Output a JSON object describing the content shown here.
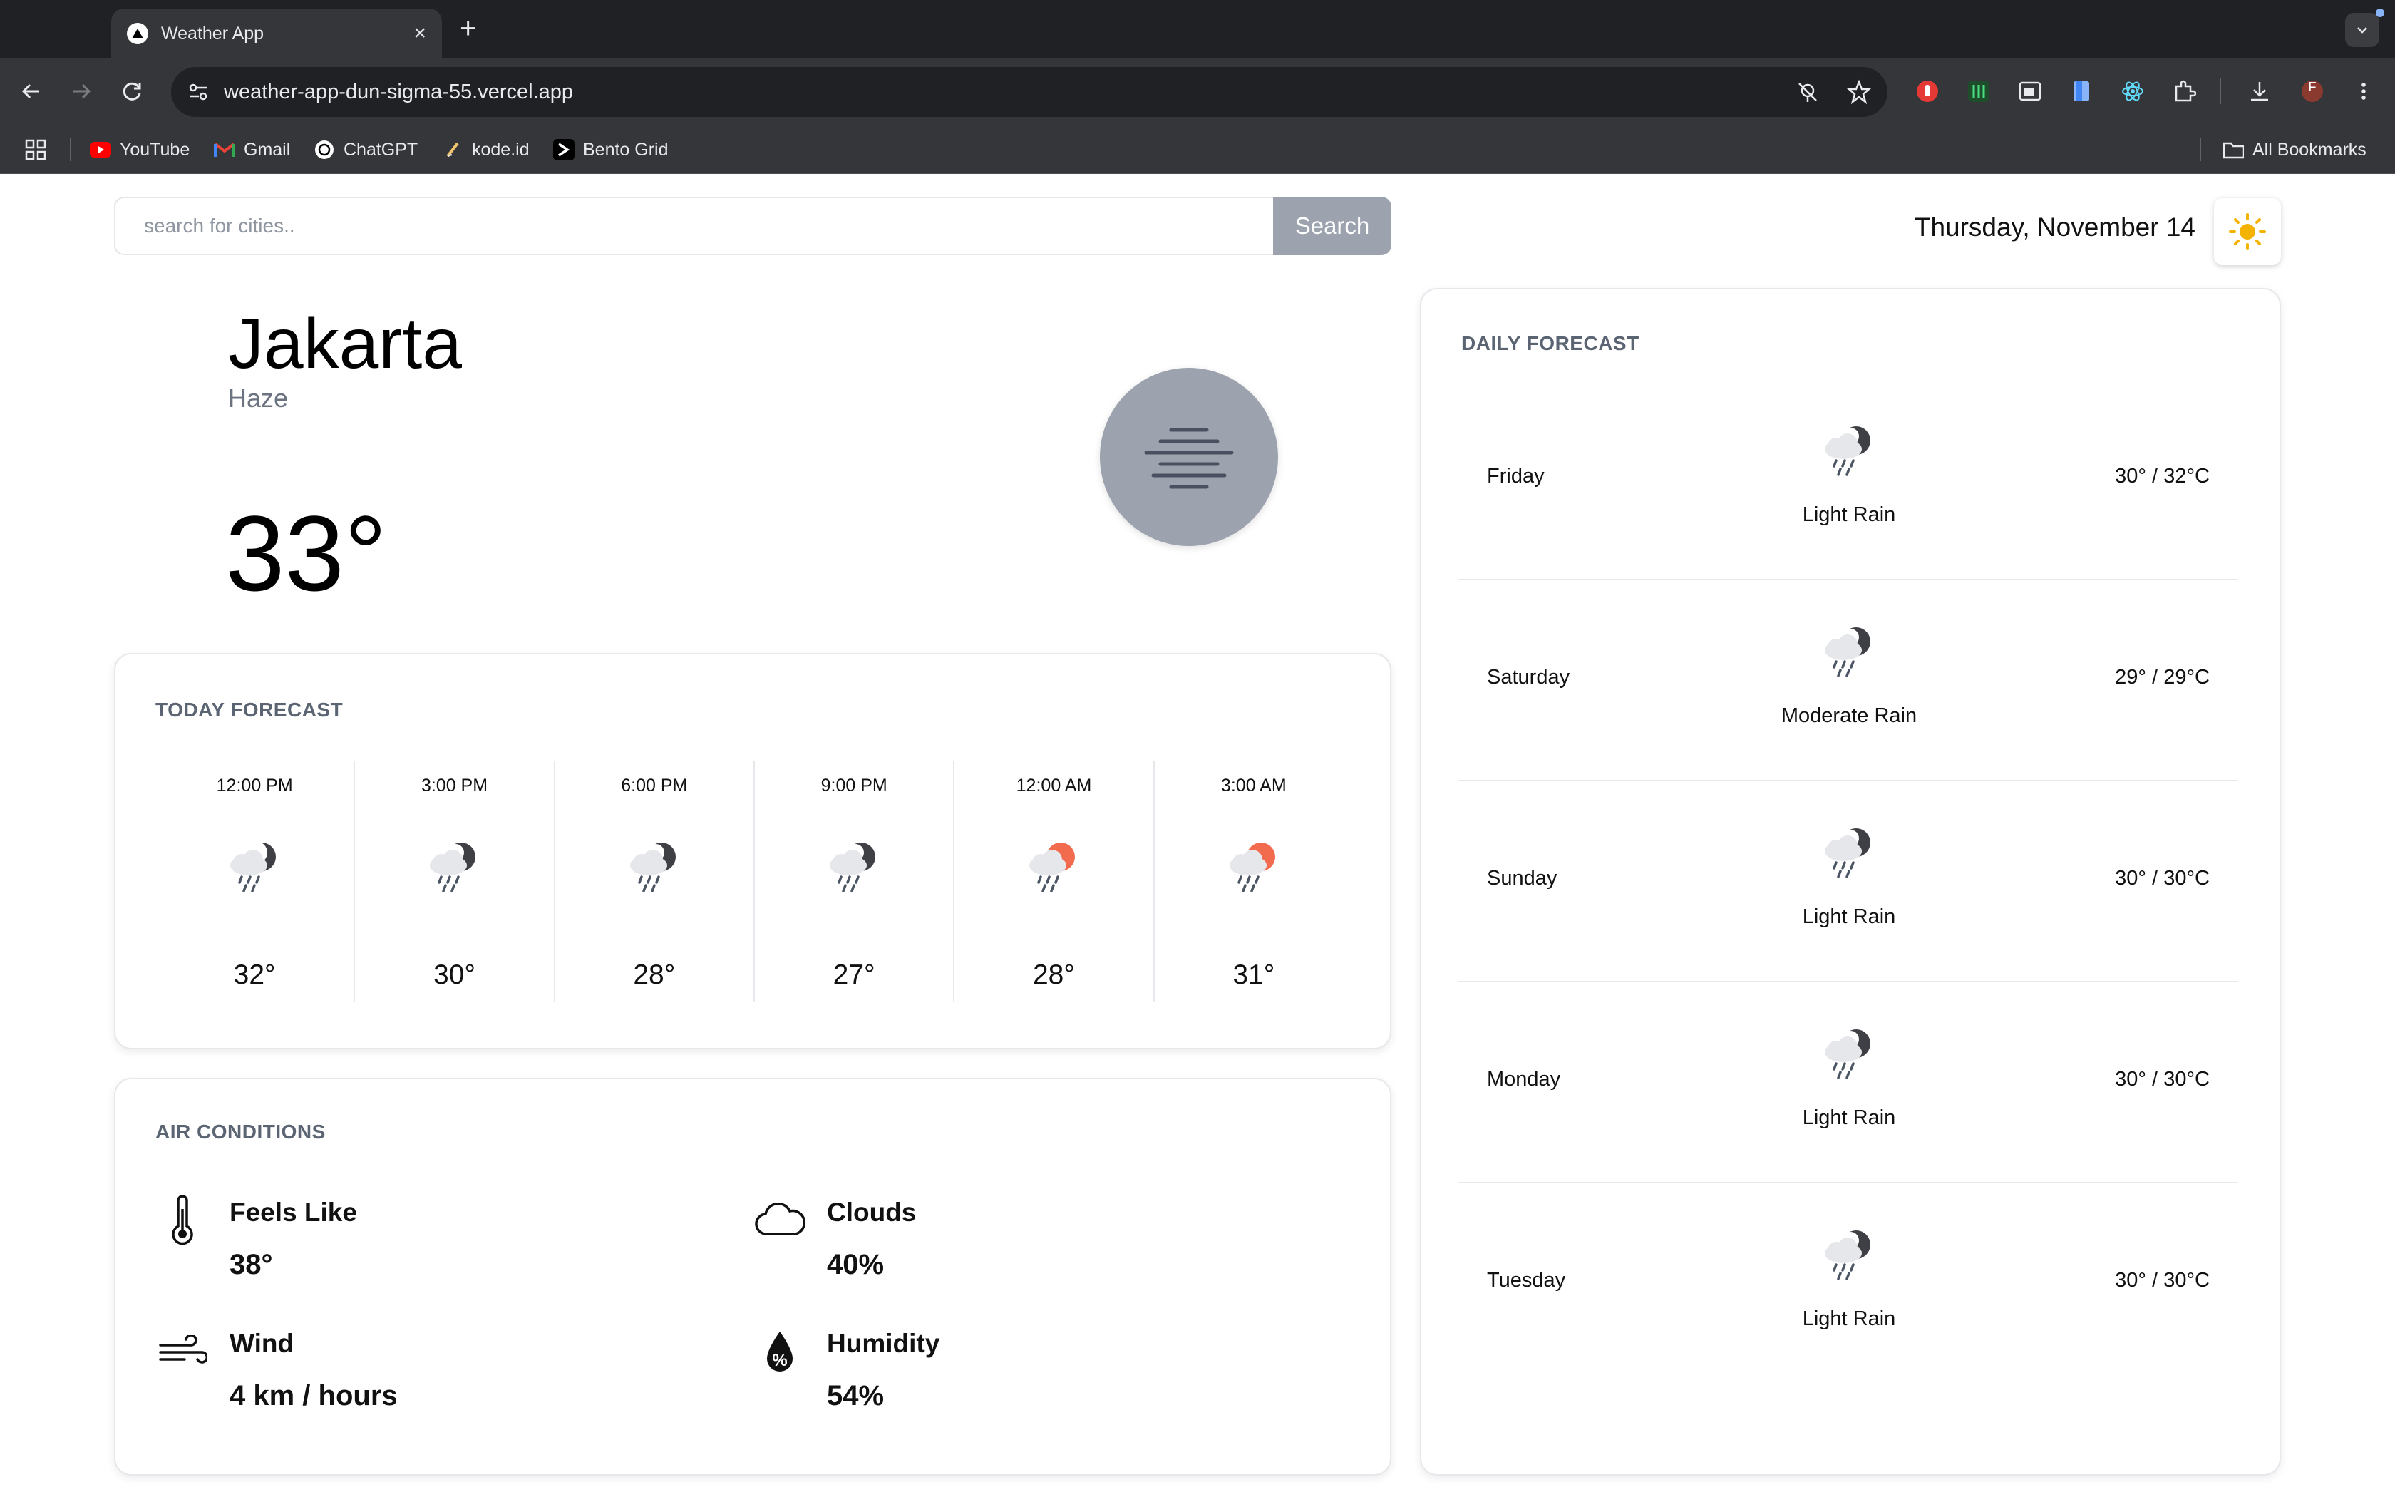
{
  "browser": {
    "tab_title": "Weather App",
    "url": "weather-app-dun-sigma-55.vercel.app",
    "bookmarks": [
      "YouTube",
      "Gmail",
      "ChatGPT",
      "kode.id",
      "Bento Grid"
    ],
    "all_bookmarks": "All Bookmarks",
    "profile_initial": "F"
  },
  "search": {
    "placeholder": "search for cities..",
    "button": "Search"
  },
  "date": "Thursday, November 14",
  "current": {
    "city": "Jakarta",
    "condition": "Haze",
    "temperature": "33°",
    "icon": "haze-icon"
  },
  "today": {
    "title": "TODAY FORECAST",
    "hours": [
      {
        "time": "12:00 PM",
        "temp": "32°",
        "icon": "night-rain-icon"
      },
      {
        "time": "3:00 PM",
        "temp": "30°",
        "icon": "night-rain-icon"
      },
      {
        "time": "6:00 PM",
        "temp": "28°",
        "icon": "night-rain-icon"
      },
      {
        "time": "9:00 PM",
        "temp": "27°",
        "icon": "night-rain-icon"
      },
      {
        "time": "12:00 AM",
        "temp": "28°",
        "icon": "sun-rain-icon"
      },
      {
        "time": "3:00 AM",
        "temp": "31°",
        "icon": "sun-rain-icon"
      }
    ]
  },
  "air": {
    "title": "AIR CONDITIONS",
    "feels_like": {
      "label": "Feels Like",
      "value": "38°"
    },
    "clouds": {
      "label": "Clouds",
      "value": "40%"
    },
    "wind": {
      "label": "Wind",
      "value": "4 km / hours"
    },
    "humidity": {
      "label": "Humidity",
      "value": "54%"
    }
  },
  "daily": {
    "title": "DAILY FORECAST",
    "days": [
      {
        "day": "Friday",
        "desc": "Light Rain",
        "temp": "30° / 32°C"
      },
      {
        "day": "Saturday",
        "desc": "Moderate Rain",
        "temp": "29° / 29°C"
      },
      {
        "day": "Sunday",
        "desc": "Light Rain",
        "temp": "30° / 30°C"
      },
      {
        "day": "Monday",
        "desc": "Light Rain",
        "temp": "30° / 30°C"
      },
      {
        "day": "Tuesday",
        "desc": "Light Rain",
        "temp": "30° / 30°C"
      }
    ]
  },
  "colors": {
    "accent_sun": "#f5b301",
    "rain_sun": "#f26b4f",
    "muted": "#9ca3af",
    "title_gray": "#5b6472"
  }
}
